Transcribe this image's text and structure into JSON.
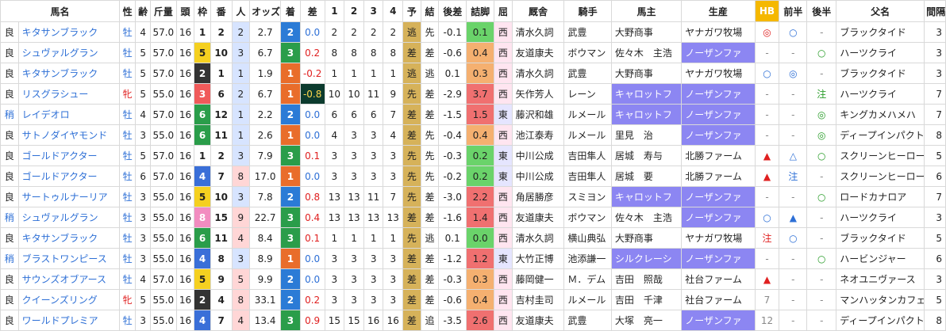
{
  "headers": [
    "馬名",
    "性",
    "齢",
    "斤量",
    "頭",
    "枠",
    "番",
    "人",
    "オッズ",
    "着",
    "差",
    "1",
    "2",
    "3",
    "4",
    "予",
    "結",
    "後差",
    "詰脚",
    "屈",
    "厩舎",
    "騎手",
    "馬主",
    "生産",
    "HB",
    "前半",
    "後半",
    "父名",
    "間隔"
  ],
  "rows": [
    {
      "track": "良",
      "horse": "キタサンブラック",
      "sex": "牡",
      "age": "4",
      "kin": "57.0",
      "heads": "16",
      "waku": "1",
      "ban": "2",
      "pop": "2",
      "odds": "2.7",
      "chaku": "2",
      "sa": "0.0",
      "c1": "2",
      "c2": "2",
      "c3": "2",
      "c4": "2",
      "yo": "逃",
      "ke": "先",
      "kosa": "-0.1",
      "tsume": "0.1",
      "kutsu": "西",
      "kyusha": "清水久詞",
      "kishu": "武豊",
      "banushi": "大野商事",
      "seisan": "ヤナガワ牧場",
      "hb": "◎",
      "zenhan": "○",
      "kohan": "-",
      "chichi": "ブラックタイド",
      "kankaku": "3"
    },
    {
      "track": "良",
      "horse": "シュヴァルグラン",
      "sex": "牡",
      "age": "5",
      "kin": "57.0",
      "heads": "16",
      "waku": "5",
      "ban": "10",
      "pop": "3",
      "odds": "6.7",
      "chaku": "3",
      "sa": "0.2",
      "c1": "8",
      "c2": "8",
      "c3": "8",
      "c4": "8",
      "yo": "差",
      "ke": "差",
      "kosa": "-0.6",
      "tsume": "0.4",
      "kutsu": "西",
      "kyusha": "友道康夫",
      "kishu": "ボウマン",
      "banushi": "佐々木　主浩",
      "seisan": "ノーザンファ",
      "hb": "-",
      "zenhan": "-",
      "kohan": "○",
      "chichi": "ハーツクライ",
      "kankaku": "3"
    },
    {
      "track": "良",
      "horse": "キタサンブラック",
      "sex": "牡",
      "age": "5",
      "kin": "57.0",
      "heads": "16",
      "waku": "2",
      "ban": "1",
      "pop": "1",
      "odds": "1.9",
      "chaku": "1",
      "sa": "-0.2",
      "c1": "1",
      "c2": "1",
      "c3": "1",
      "c4": "1",
      "yo": "逃",
      "ke": "逃",
      "kosa": "0.1",
      "tsume": "0.3",
      "kutsu": "西",
      "kyusha": "清水久詞",
      "kishu": "武豊",
      "banushi": "大野商事",
      "seisan": "ヤナガワ牧場",
      "hb": "○",
      "zenhan": "◎",
      "kohan": "-",
      "chichi": "ブラックタイド",
      "kankaku": "3"
    },
    {
      "track": "良",
      "horse": "リスグラシュー",
      "sex": "牝",
      "age": "5",
      "kin": "55.0",
      "heads": "16",
      "waku": "3",
      "ban": "6",
      "pop": "2",
      "odds": "6.7",
      "chaku": "1",
      "sa": "-0.8",
      "c1": "10",
      "c2": "10",
      "c3": "11",
      "c4": "9",
      "yo": "先",
      "ke": "差",
      "kosa": "-2.9",
      "tsume": "3.7",
      "kutsu": "西",
      "kyusha": "矢作芳人",
      "kishu": "レーン",
      "banushi": "キャロットフ",
      "seisan": "ノーザンファ",
      "hb": "-",
      "zenhan": "-",
      "kohan": "注",
      "chichi": "ハーツクライ",
      "kankaku": "7"
    },
    {
      "track": "稍",
      "horse": "レイデオロ",
      "sex": "牡",
      "age": "4",
      "kin": "57.0",
      "heads": "16",
      "waku": "6",
      "ban": "12",
      "pop": "1",
      "odds": "2.2",
      "chaku": "2",
      "sa": "0.0",
      "c1": "6",
      "c2": "6",
      "c3": "6",
      "c4": "7",
      "yo": "差",
      "ke": "差",
      "kosa": "-1.5",
      "tsume": "1.5",
      "kutsu": "東",
      "kyusha": "藤沢和雄",
      "kishu": "ルメール",
      "banushi": "キャロットフ",
      "seisan": "ノーザンファ",
      "hb": "-",
      "zenhan": "-",
      "kohan": "◎",
      "chichi": "キングカメハメハ",
      "kankaku": "7"
    },
    {
      "track": "良",
      "horse": "サトノダイヤモンド",
      "sex": "牡",
      "age": "3",
      "kin": "55.0",
      "heads": "16",
      "waku": "6",
      "ban": "11",
      "pop": "1",
      "odds": "2.6",
      "chaku": "1",
      "sa": "0.0",
      "c1": "4",
      "c2": "3",
      "c3": "3",
      "c4": "4",
      "yo": "差",
      "ke": "先",
      "kosa": "-0.4",
      "tsume": "0.4",
      "kutsu": "西",
      "kyusha": "池江泰寿",
      "kishu": "ルメール",
      "banushi": "里見　治",
      "seisan": "ノーザンファ",
      "hb": "-",
      "zenhan": "-",
      "kohan": "◎",
      "chichi": "ディープインパクト",
      "kankaku": "8"
    },
    {
      "track": "良",
      "horse": "ゴールドアクター",
      "sex": "牡",
      "age": "5",
      "kin": "57.0",
      "heads": "16",
      "waku": "1",
      "ban": "2",
      "pop": "3",
      "odds": "7.9",
      "chaku": "3",
      "sa": "0.1",
      "c1": "3",
      "c2": "3",
      "c3": "3",
      "c4": "3",
      "yo": "先",
      "ke": "先",
      "kosa": "-0.3",
      "tsume": "0.2",
      "kutsu": "東",
      "kyusha": "中川公成",
      "kishu": "吉田隼人",
      "banushi": "居城　寿与",
      "seisan": "北勝ファーム",
      "hb": "▲",
      "zenhan": "△",
      "kohan": "○",
      "chichi": "スクリーンヒーロー",
      "kankaku": "5"
    },
    {
      "track": "良",
      "horse": "ゴールドアクター",
      "sex": "牡",
      "age": "6",
      "kin": "57.0",
      "heads": "16",
      "waku": "4",
      "ban": "7",
      "pop": "8",
      "odds": "17.0",
      "chaku": "1",
      "sa": "0.0",
      "c1": "3",
      "c2": "3",
      "c3": "3",
      "c4": "3",
      "yo": "先",
      "ke": "先",
      "kosa": "-0.2",
      "tsume": "0.2",
      "kutsu": "東",
      "kyusha": "中川公成",
      "kishu": "吉田隼人",
      "banushi": "居城　要",
      "seisan": "北勝ファーム",
      "hb": "▲",
      "zenhan": "注",
      "kohan": "-",
      "chichi": "スクリーンヒーロー",
      "kankaku": "6"
    },
    {
      "track": "良",
      "horse": "サートゥルナーリア",
      "sex": "牡",
      "age": "3",
      "kin": "55.0",
      "heads": "16",
      "waku": "5",
      "ban": "10",
      "pop": "3",
      "odds": "7.8",
      "chaku": "2",
      "sa": "0.8",
      "c1": "13",
      "c2": "13",
      "c3": "11",
      "c4": "7",
      "yo": "先",
      "ke": "差",
      "kosa": "-3.0",
      "tsume": "2.2",
      "kutsu": "西",
      "kyusha": "角居勝彦",
      "kishu": "スミヨン",
      "banushi": "キャロットフ",
      "seisan": "ノーザンファ",
      "hb": "-",
      "zenhan": "-",
      "kohan": "○",
      "chichi": "ロードカナロア",
      "kankaku": "7"
    },
    {
      "track": "稍",
      "horse": "シュヴァルグラン",
      "sex": "牡",
      "age": "3",
      "kin": "55.0",
      "heads": "16",
      "waku": "8",
      "ban": "15",
      "pop": "9",
      "odds": "22.7",
      "chaku": "3",
      "sa": "0.4",
      "c1": "13",
      "c2": "13",
      "c3": "13",
      "c4": "13",
      "yo": "差",
      "ke": "差",
      "kosa": "-1.6",
      "tsume": "1.4",
      "kutsu": "西",
      "kyusha": "友道康夫",
      "kishu": "ボウマン",
      "banushi": "佐々木　主浩",
      "seisan": "ノーザンファ",
      "hb": "○",
      "zenhan": "▲",
      "kohan": "-",
      "chichi": "ハーツクライ",
      "kankaku": "3"
    },
    {
      "track": "良",
      "horse": "キタサンブラック",
      "sex": "牡",
      "age": "3",
      "kin": "55.0",
      "heads": "16",
      "waku": "6",
      "ban": "11",
      "pop": "4",
      "odds": "8.4",
      "chaku": "3",
      "sa": "0.1",
      "c1": "1",
      "c2": "1",
      "c3": "1",
      "c4": "1",
      "yo": "先",
      "ke": "逃",
      "kosa": "0.1",
      "tsume": "0.0",
      "kutsu": "西",
      "kyusha": "清水久詞",
      "kishu": "横山典弘",
      "banushi": "大野商事",
      "seisan": "ヤナガワ牧場",
      "hb": "注",
      "zenhan": "○",
      "kohan": "-",
      "chichi": "ブラックタイド",
      "kankaku": "5"
    },
    {
      "track": "稍",
      "horse": "ブラストワンピース",
      "sex": "牡",
      "age": "3",
      "kin": "55.0",
      "heads": "16",
      "waku": "4",
      "ban": "8",
      "pop": "3",
      "odds": "8.9",
      "chaku": "1",
      "sa": "0.0",
      "c1": "3",
      "c2": "3",
      "c3": "3",
      "c4": "3",
      "yo": "差",
      "ke": "差",
      "kosa": "-1.2",
      "tsume": "1.2",
      "kutsu": "東",
      "kyusha": "大竹正博",
      "kishu": "池添謙一",
      "banushi": "シルクレーシ",
      "seisan": "ノーザンファ",
      "hb": "-",
      "zenhan": "-",
      "kohan": "○",
      "chichi": "ハービンジャー",
      "kankaku": "6"
    },
    {
      "track": "良",
      "horse": "サウンズオブアース",
      "sex": "牡",
      "age": "4",
      "kin": "57.0",
      "heads": "16",
      "waku": "5",
      "ban": "9",
      "pop": "5",
      "odds": "9.9",
      "chaku": "2",
      "sa": "0.0",
      "c1": "3",
      "c2": "3",
      "c3": "3",
      "c4": "3",
      "yo": "差",
      "ke": "差",
      "kosa": "-0.3",
      "tsume": "0.3",
      "kutsu": "西",
      "kyusha": "藤岡健一",
      "kishu": "Ｍ．デム",
      "banushi": "吉田　照哉",
      "seisan": "社台ファーム",
      "hb": "▲",
      "zenhan": "-",
      "kohan": "-",
      "chichi": "ネオユニヴァース",
      "kankaku": "3"
    },
    {
      "track": "良",
      "horse": "クイーンズリング",
      "sex": "牝",
      "age": "5",
      "kin": "55.0",
      "heads": "16",
      "waku": "2",
      "ban": "4",
      "pop": "8",
      "odds": "33.1",
      "chaku": "2",
      "sa": "0.2",
      "c1": "3",
      "c2": "3",
      "c3": "3",
      "c4": "3",
      "yo": "差",
      "ke": "差",
      "kosa": "-0.6",
      "tsume": "0.4",
      "kutsu": "西",
      "kyusha": "吉村圭司",
      "kishu": "ルメール",
      "banushi": "吉田　千津",
      "seisan": "社台ファーム",
      "hb": "7",
      "zenhan": "-",
      "kohan": "-",
      "chichi": "マンハッタンカフェ",
      "kankaku": "5"
    },
    {
      "track": "良",
      "horse": "ワールドプレミア",
      "sex": "牡",
      "age": "3",
      "kin": "55.0",
      "heads": "16",
      "waku": "4",
      "ban": "7",
      "pop": "4",
      "odds": "13.4",
      "chaku": "3",
      "sa": "0.9",
      "c1": "15",
      "c2": "15",
      "c3": "16",
      "c4": "16",
      "yo": "差",
      "ke": "追",
      "kosa": "-3.5",
      "tsume": "2.6",
      "kutsu": "西",
      "kyusha": "友道康夫",
      "kishu": "武豊",
      "banushi": "大塚　亮一",
      "seisan": "ノーザンファ",
      "hb": "12",
      "zenhan": "-",
      "kohan": "-",
      "chichi": "ディープインパクト",
      "kankaku": "8"
    }
  ],
  "colors": {
    "waku": {
      "1": "#ffffff",
      "2": "#333333",
      "3": "#f05a5a",
      "4": "#3a6fd8",
      "5": "#f5d020",
      "6": "#2a9d4a",
      "7": "#f5a623",
      "8": "#f28cc0"
    },
    "chaku": {
      "1": "#e96d2b",
      "2": "#2b7bd6",
      "3": "#2a9d4a"
    },
    "yo": "#d6b25a",
    "kutsu_east": "#e5e5ff",
    "kutsu_west": "#ffe5f0",
    "tsume_green": "#6ad36a",
    "tsume_orange": "#f5b070",
    "tsume_red": "#f07070",
    "purple": "#8c86f2",
    "pop_blue": "#d7e4ff",
    "pop_red": "#ffd6d6"
  }
}
